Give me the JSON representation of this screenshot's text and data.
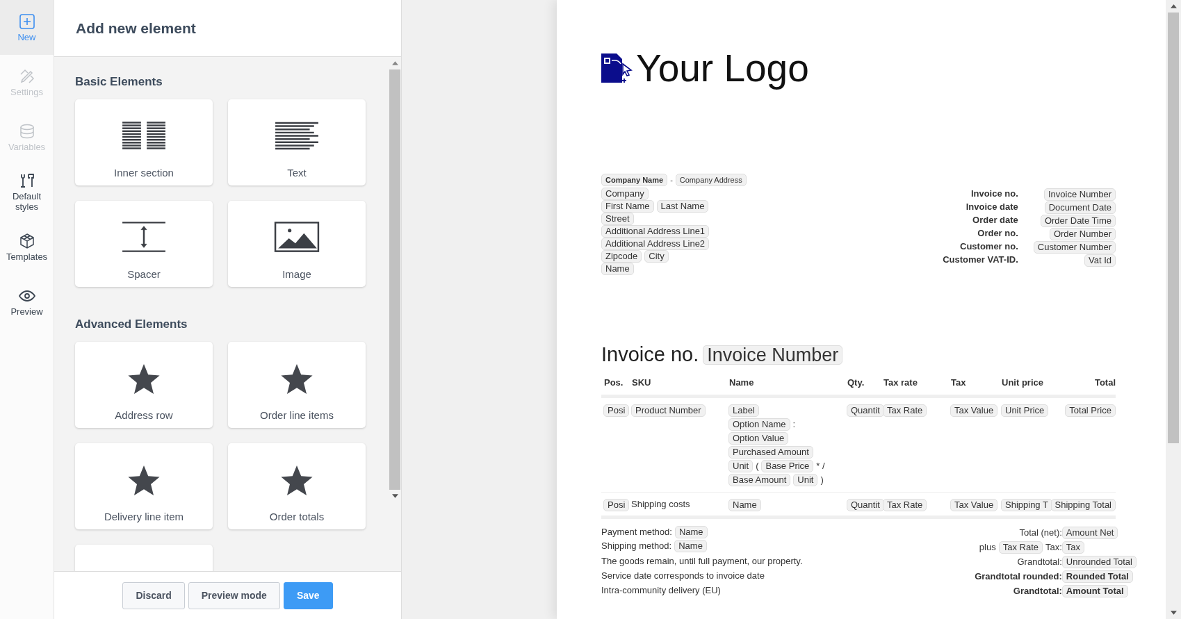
{
  "sidebar": {
    "items": [
      {
        "label": "New",
        "kind": "plus",
        "selected": true,
        "disabled": false
      },
      {
        "label": "Settings",
        "kind": "pencil",
        "selected": false,
        "disabled": true
      },
      {
        "label": "Variables",
        "kind": "database",
        "selected": false,
        "disabled": true
      },
      {
        "label": "Default styles",
        "kind": "tools",
        "selected": false,
        "disabled": false
      },
      {
        "label": "Templates",
        "kind": "cube",
        "selected": false,
        "disabled": false
      },
      {
        "label": "Preview",
        "kind": "eye",
        "selected": false,
        "disabled": false
      }
    ]
  },
  "panel": {
    "title": "Add new element",
    "sections": [
      {
        "title": "Basic Elements",
        "items": [
          {
            "label": "Inner section",
            "kind": "columns"
          },
          {
            "label": "Text",
            "kind": "text"
          },
          {
            "label": "Spacer",
            "kind": "spacer"
          },
          {
            "label": "Image",
            "kind": "image"
          }
        ]
      },
      {
        "title": "Advanced Elements",
        "items": [
          {
            "label": "Address row",
            "kind": "star"
          },
          {
            "label": "Order line items",
            "kind": "star"
          },
          {
            "label": "Delivery line item",
            "kind": "star"
          },
          {
            "label": "Order totals",
            "kind": "star"
          },
          {
            "kind": "partial"
          }
        ]
      }
    ],
    "buttons": [
      {
        "label": "Discard",
        "kind": "secondary"
      },
      {
        "label": "Preview mode",
        "kind": "secondary"
      },
      {
        "label": "Save",
        "kind": "primary"
      }
    ]
  },
  "document": {
    "logo_text": "Your Logo",
    "sender_line": [
      {
        "text": "Company Name",
        "kind": "chip",
        "bold": true
      },
      {
        "text": "-",
        "kind": "text",
        "bold": false
      },
      {
        "text": "Company Address",
        "kind": "chip",
        "bold": false
      }
    ],
    "address_lines": [
      [
        {
          "text": "Company",
          "kind": "chip"
        }
      ],
      [
        {
          "text": "First Name",
          "kind": "chip"
        },
        {
          "text": "Last Name",
          "kind": "chip"
        }
      ],
      [
        {
          "text": "Street",
          "kind": "chip"
        }
      ],
      [
        {
          "text": "Additional Address Line1",
          "kind": "chip"
        }
      ],
      [
        {
          "text": "Additional Address Line2",
          "kind": "chip"
        }
      ],
      [
        {
          "text": "Zipcode",
          "kind": "chip"
        },
        {
          "text": "City",
          "kind": "chip"
        }
      ],
      [
        {
          "text": "Name",
          "kind": "chip"
        }
      ]
    ],
    "meta": [
      {
        "label": "Invoice no.",
        "value": "Invoice Number"
      },
      {
        "label": "Invoice date",
        "value": "Document Date"
      },
      {
        "label": "Order date",
        "value": "Order Date Time"
      },
      {
        "label": "Order no.",
        "value": "Order Number"
      },
      {
        "label": "Customer no.",
        "value": "Customer Number"
      },
      {
        "label": "Customer VAT-ID.",
        "value": "Vat Id"
      }
    ],
    "heading": {
      "label": "Invoice no.",
      "value": "Invoice Number"
    },
    "table": {
      "columns": [
        "Pos.",
        "SKU",
        "Name",
        "Qty.",
        "Tax rate",
        "Tax",
        "Unit price",
        "Total"
      ],
      "rows": [
        {
          "cells": [
            [
              [
                {
                  "text": "Posi",
                  "kind": "chip"
                }
              ]
            ],
            [
              [
                {
                  "text": "Product Number",
                  "kind": "chip"
                }
              ]
            ],
            [
              [
                {
                  "text": "Label",
                  "kind": "chip"
                }
              ],
              [
                {
                  "text": "Option Name",
                  "kind": "chip"
                },
                {
                  "text": ":",
                  "kind": "text"
                }
              ],
              [
                {
                  "text": "Option Value",
                  "kind": "chip"
                }
              ],
              [
                {
                  "text": "Purchased Amount",
                  "kind": "chip"
                }
              ],
              [
                {
                  "text": "Unit",
                  "kind": "chip"
                },
                {
                  "text": "(",
                  "kind": "text"
                },
                {
                  "text": "Base Price",
                  "kind": "chip"
                },
                {
                  "text": "* /",
                  "kind": "text"
                }
              ],
              [
                {
                  "text": "Base Amount",
                  "kind": "chip"
                },
                {
                  "text": "Unit",
                  "kind": "chip"
                },
                {
                  "text": ")",
                  "kind": "text"
                }
              ]
            ],
            [
              [
                {
                  "text": "Quantit",
                  "kind": "chip"
                }
              ]
            ],
            [
              [
                {
                  "text": "Tax Rate",
                  "kind": "chip"
                }
              ]
            ],
            [
              [
                {
                  "text": "Tax Value",
                  "kind": "chip"
                }
              ]
            ],
            [
              [
                {
                  "text": "Unit Price",
                  "kind": "chip"
                }
              ]
            ],
            [
              [
                {
                  "text": "Total Price",
                  "kind": "chip"
                }
              ]
            ]
          ]
        },
        {
          "cells": [
            [
              [
                {
                  "text": "Posi",
                  "kind": "chip"
                }
              ]
            ],
            [
              [
                {
                  "text": "Shipping costs",
                  "kind": "text"
                }
              ]
            ],
            [
              [
                {
                  "text": "Name",
                  "kind": "chip"
                }
              ]
            ],
            [
              [
                {
                  "text": "Quantit",
                  "kind": "chip"
                }
              ]
            ],
            [
              [
                {
                  "text": "Tax Rate",
                  "kind": "chip"
                }
              ]
            ],
            [
              [
                {
                  "text": "Tax Value",
                  "kind": "chip"
                }
              ]
            ],
            [
              [
                {
                  "text": "Shipping T",
                  "kind": "chip"
                }
              ]
            ],
            [
              [
                {
                  "text": "Shipping Total",
                  "kind": "chip"
                }
              ]
            ]
          ]
        }
      ]
    },
    "payment_lines": [
      {
        "label": "Payment method:",
        "value": "Name"
      },
      {
        "label": "Shipping method:",
        "value": "Name"
      }
    ],
    "notes": [
      "The goods remain, until full payment, our property.",
      "Service date corresponds to invoice date",
      "Intra-community delivery (EU)"
    ],
    "totals": [
      {
        "bold": false,
        "label": [
          {
            "text": "Total (net):",
            "kind": "text"
          }
        ],
        "value": "Amount Net"
      },
      {
        "bold": false,
        "label": [
          {
            "text": "plus",
            "kind": "text"
          },
          {
            "text": "Tax Rate",
            "kind": "chip"
          },
          {
            "text": "Tax:",
            "kind": "text"
          }
        ],
        "value": "Tax"
      },
      {
        "bold": false,
        "label": [
          {
            "text": "Grandtotal:",
            "kind": "text"
          }
        ],
        "value": "Unrounded Total"
      },
      {
        "bold": true,
        "label": [
          {
            "text": "Grandtotal rounded:",
            "kind": "text"
          }
        ],
        "value": "Rounded Total"
      },
      {
        "bold": true,
        "label": [
          {
            "text": "Grandtotal:",
            "kind": "text"
          }
        ],
        "value": "Amount Total"
      }
    ]
  }
}
